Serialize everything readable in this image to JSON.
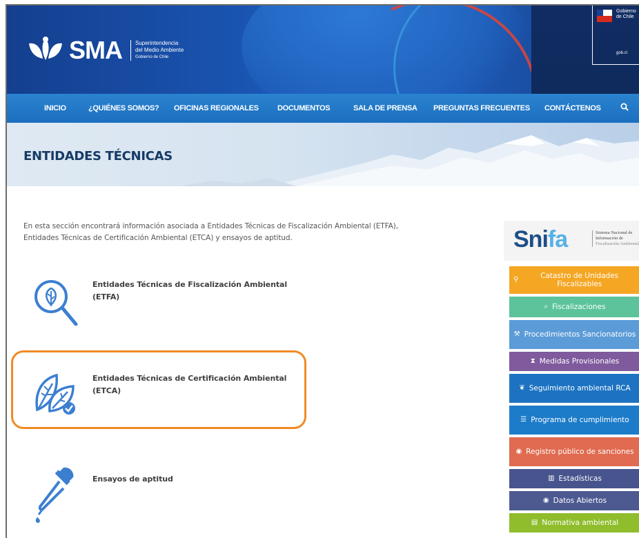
{
  "header": {
    "logo_text": "SMA",
    "logo_sub_1": "Superintendencia",
    "logo_sub_2": "del Medio Ambiente",
    "logo_sub_3": "Gobierno de Chile",
    "gob_line1": "Gobierno",
    "gob_line2": "de Chile",
    "gob_bottom": "gob.cl"
  },
  "nav": {
    "items": [
      {
        "label": "INICIO"
      },
      {
        "label": "¿QUIÉNES SOMOS?"
      },
      {
        "label": "OFICINAS REGIONALES"
      },
      {
        "label": "DOCUMENTOS"
      },
      {
        "label": "SALA DE PRENSA"
      },
      {
        "label": "PREGUNTAS FRECUENTES"
      },
      {
        "label": "CONTÁCTENOS"
      }
    ]
  },
  "banner": {
    "title": "ENTIDADES TÉCNICAS"
  },
  "content": {
    "intro_1": "En esta sección encontrará información asociada a Entidades Técnicas de Fiscalización Ambiental (ETFA),",
    "intro_2": "Entidades Técnicas de Certificación Ambiental (ETCA) y ensayos de aptitud.",
    "entries": [
      {
        "line1": "Entidades Técnicas de Fiscalización Ambiental",
        "line2": "(ETFA)"
      },
      {
        "line1": "Entidades Técnicas de Certificación Ambiental",
        "line2": "(ETCA)"
      },
      {
        "line1": "Ensayos de aptitud",
        "line2": ""
      }
    ]
  },
  "sidebar": {
    "brand_a": "Sni",
    "brand_b": "fa",
    "desc_1": "Sistema Nacional de",
    "desc_2": "Información de",
    "desc_3": "Fiscalización Ambiental",
    "buttons": [
      {
        "label": "Catastro de Unidades Fiscalizables",
        "icon": "map-marker-icon",
        "color": "#f5a623"
      },
      {
        "label": "Fiscalizaciones",
        "icon": "search-icon",
        "color": "#5cc39a"
      },
      {
        "label": "Procedimientos Sancionatorios",
        "icon": "gavel-icon",
        "color": "#5b9bd8"
      },
      {
        "label": "Medidas Provisionales",
        "icon": "hourglass-icon",
        "color": "#7f5a9d"
      },
      {
        "label": "Seguimiento ambiental RCA",
        "icon": "leaf-icon",
        "color": "#1d73c2"
      },
      {
        "label": "Programa de cumplimiento",
        "icon": "list-icon",
        "color": "#1d7cc9"
      },
      {
        "label": "Registro público de sanciones",
        "icon": "eye-icon",
        "color": "#e06b50"
      },
      {
        "label": "Estadísticas",
        "icon": "chart-icon",
        "color": "#47548d"
      },
      {
        "label": "Datos Abiertos",
        "icon": "eye-icon",
        "color": "#4d5a91"
      },
      {
        "label": "Normativa ambiental",
        "icon": "document-icon",
        "color": "#8fbd2c"
      }
    ]
  },
  "colors": {
    "header_blue": "#1a56b4",
    "nav_blue": "#2a83cf",
    "title_navy": "#163a66",
    "highlight_orange": "#f08a24",
    "icon_blue": "#3c7fd1"
  }
}
